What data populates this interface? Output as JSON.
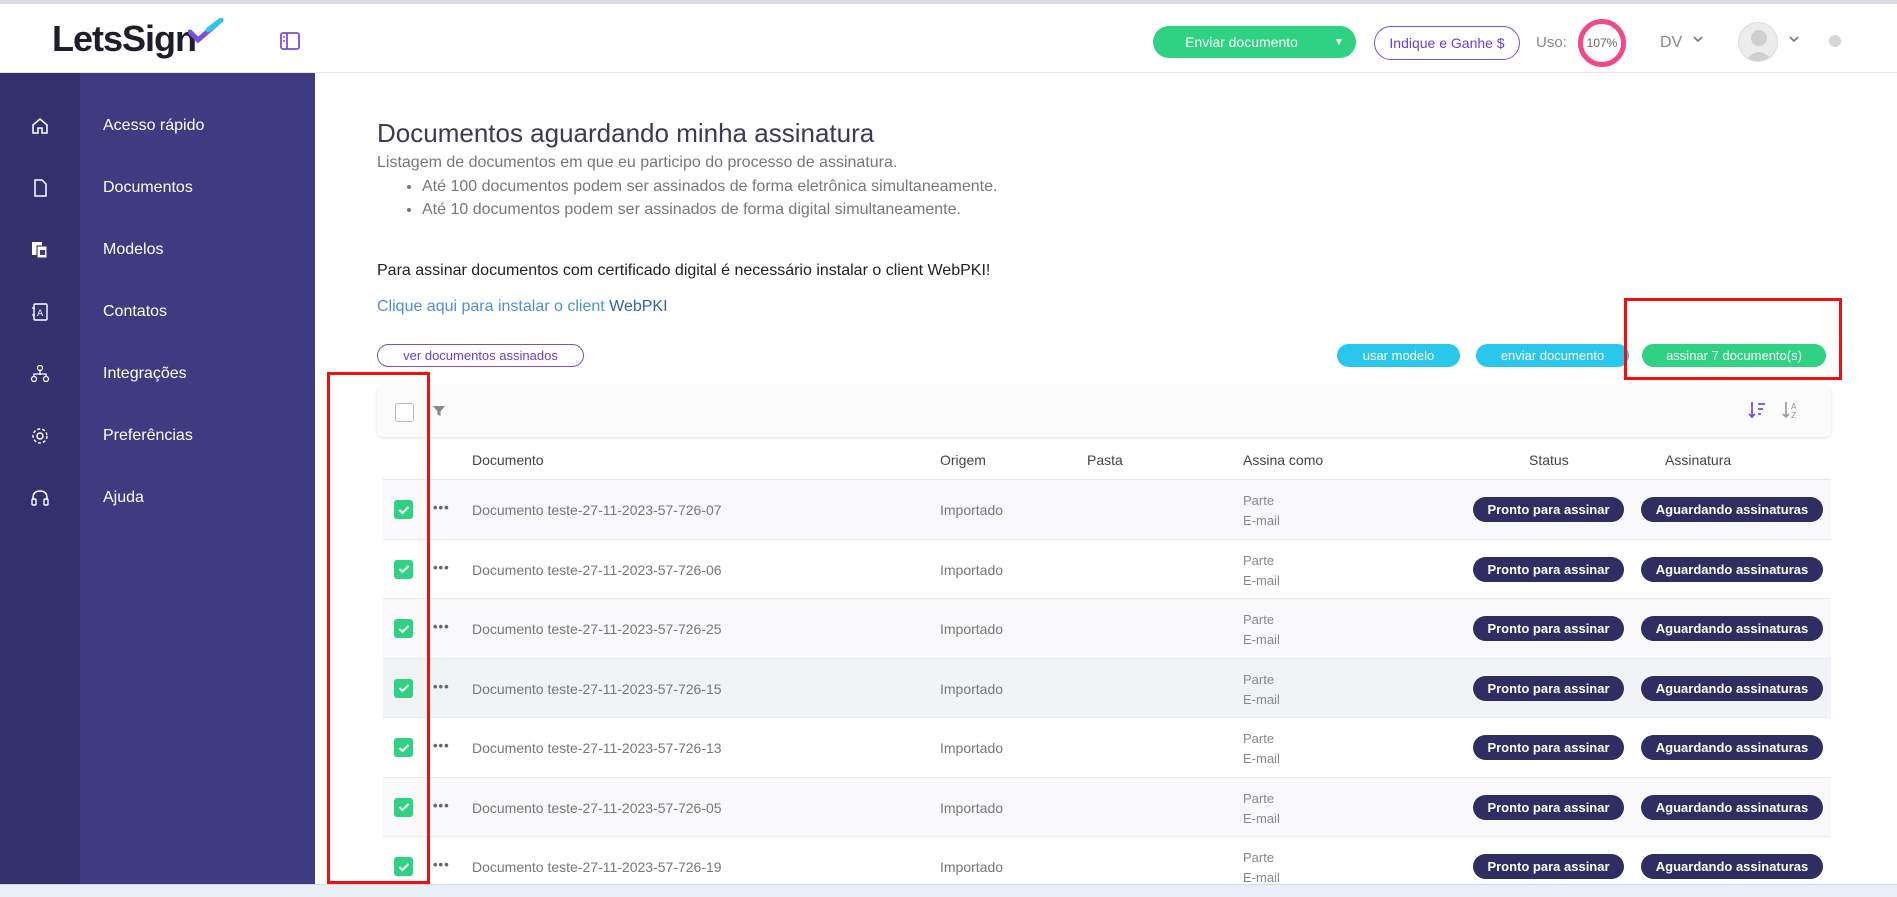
{
  "brand": {
    "name": "LetsSign"
  },
  "header": {
    "send_button": "Enviar documento",
    "refer_button": "Indique e Ganhe $",
    "usage_label": "Uso:",
    "usage_value": "107%",
    "user_initials": "DV"
  },
  "sidebar": {
    "items": [
      {
        "label": "Acesso rápido",
        "icon": "home-icon"
      },
      {
        "label": "Documentos",
        "icon": "document-icon"
      },
      {
        "label": "Modelos",
        "icon": "templates-icon"
      },
      {
        "label": "Contatos",
        "icon": "contacts-icon"
      },
      {
        "label": "Integrações",
        "icon": "integrations-icon"
      },
      {
        "label": "Preferências",
        "icon": "gear-icon"
      },
      {
        "label": "Ajuda",
        "icon": "headset-icon"
      }
    ]
  },
  "page": {
    "title": "Documentos aguardando minha assinatura",
    "subtitle": "Listagem de documentos em que eu participo do processo de assinatura.",
    "bullets": [
      "Até 100 documentos podem ser assinados de forma eletrônica simultaneamente.",
      "Até 10 documentos podem ser assinados de forma digital simultaneamente."
    ],
    "cert_note": "Para assinar documentos com certificado digital é necessário instalar o client WebPKI!",
    "cert_link_prefix": "Clique aqui para instalar o client ",
    "cert_link_strong": "WebPKI"
  },
  "actions": {
    "view_signed": "ver documentos assinados",
    "use_template": "usar modelo",
    "send_document": "enviar documento",
    "sign_selected": "assinar 7 documento(s)"
  },
  "table": {
    "headers": {
      "document": "Documento",
      "origin": "Origem",
      "folder": "Pasta",
      "signs_as": "Assina como",
      "status": "Status",
      "signature": "Assinatura"
    },
    "rows": [
      {
        "document": "Documento teste-27-11-2023-57-726-07",
        "origin": "Importado",
        "folder": "",
        "role": "Parte",
        "channel": "E-mail",
        "status": "Pronto para assinar",
        "signature": "Aguardando assinaturas",
        "checked": true
      },
      {
        "document": "Documento teste-27-11-2023-57-726-06",
        "origin": "Importado",
        "folder": "",
        "role": "Parte",
        "channel": "E-mail",
        "status": "Pronto para assinar",
        "signature": "Aguardando assinaturas",
        "checked": true
      },
      {
        "document": "Documento teste-27-11-2023-57-726-25",
        "origin": "Importado",
        "folder": "",
        "role": "Parte",
        "channel": "E-mail",
        "status": "Pronto para assinar",
        "signature": "Aguardando assinaturas",
        "checked": true
      },
      {
        "document": "Documento teste-27-11-2023-57-726-15",
        "origin": "Importado",
        "folder": "",
        "role": "Parte",
        "channel": "E-mail",
        "status": "Pronto para assinar",
        "signature": "Aguardando assinaturas",
        "checked": true
      },
      {
        "document": "Documento teste-27-11-2023-57-726-13",
        "origin": "Importado",
        "folder": "",
        "role": "Parte",
        "channel": "E-mail",
        "status": "Pronto para assinar",
        "signature": "Aguardando assinaturas",
        "checked": true
      },
      {
        "document": "Documento teste-27-11-2023-57-726-05",
        "origin": "Importado",
        "folder": "",
        "role": "Parte",
        "channel": "E-mail",
        "status": "Pronto para assinar",
        "signature": "Aguardando assinaturas",
        "checked": true
      },
      {
        "document": "Documento teste-27-11-2023-57-726-19",
        "origin": "Importado",
        "folder": "",
        "role": "Parte",
        "channel": "E-mail",
        "status": "Pronto para assinar",
        "signature": "Aguardando assinaturas",
        "checked": true
      }
    ]
  },
  "colors": {
    "sidebar_dark": "#33306e",
    "sidebar": "#3e3b80",
    "green": "#2ed282",
    "cyan": "#2bc6ec",
    "purple": "#7b4fd6",
    "badge_navy": "#2f2e63",
    "usage_ring": "#f0488a",
    "highlight_red": "#ee1111"
  }
}
